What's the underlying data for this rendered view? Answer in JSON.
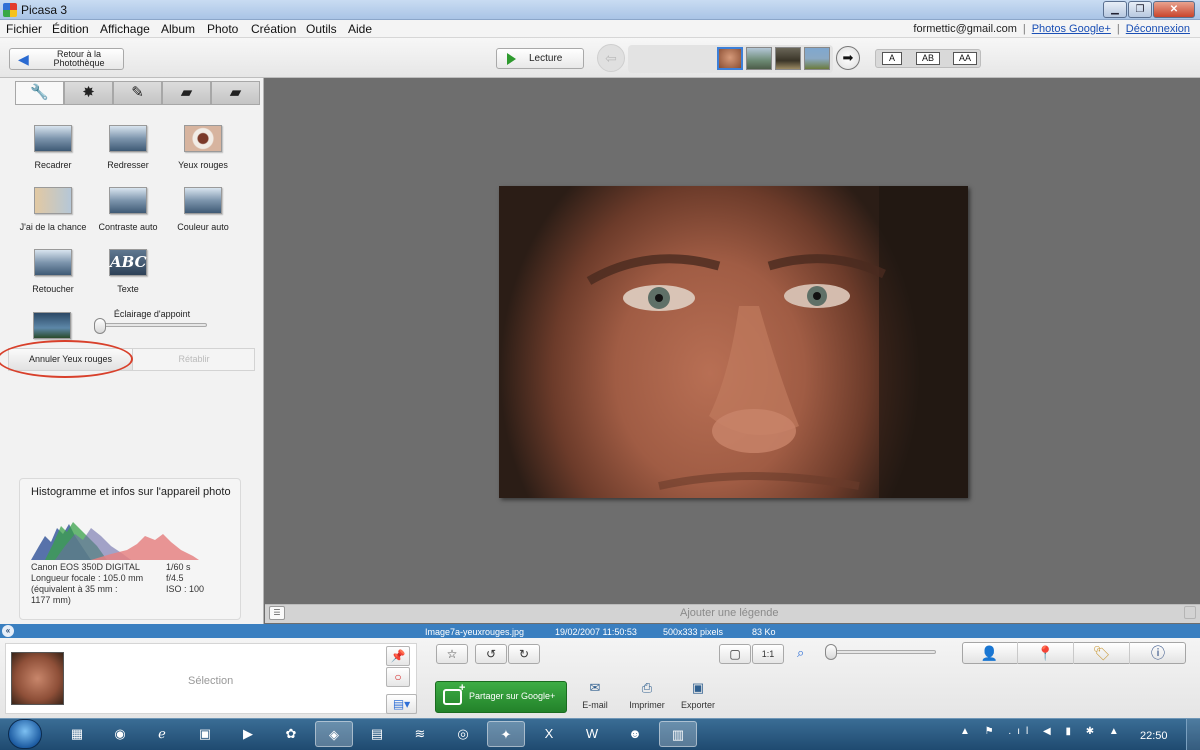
{
  "window": {
    "title": "Picasa 3"
  },
  "menu": [
    "Fichier",
    "Édition",
    "Affichage",
    "Album",
    "Photo",
    "Création",
    "Outils",
    "Aide"
  ],
  "account": {
    "email": "formettic@gmail.com",
    "photos_link": "Photos Google+",
    "logout": "Déconnexion"
  },
  "toolbar": {
    "back_label": "Retour à la Photothèque",
    "play_label": "Lecture",
    "caption_modes": [
      "A",
      "AB",
      "AA"
    ]
  },
  "tabs": [
    "wrench-icon",
    "sun-tuning-icon",
    "brush-icon",
    "effects-icon",
    "effects-2-icon"
  ],
  "tools": [
    {
      "label": "Recadrer",
      "icon": "crop-icon"
    },
    {
      "label": "Redresser",
      "icon": "straighten-icon"
    },
    {
      "label": "Yeux rouges",
      "icon": "red-eye-icon"
    },
    {
      "label": "J'ai de la chance",
      "icon": "lucky-icon"
    },
    {
      "label": "Contraste auto",
      "icon": "auto-contrast-icon"
    },
    {
      "label": "Couleur auto",
      "icon": "auto-color-icon"
    },
    {
      "label": "Retoucher",
      "icon": "retouch-icon"
    },
    {
      "label": "Texte",
      "icon": "text-icon",
      "glyph": "ABC"
    }
  ],
  "fill_light": {
    "label": "Éclairage d'appoint",
    "value": 0
  },
  "history": {
    "undo": "Annuler Yeux rouges",
    "redo": "Rétablir"
  },
  "histogram": {
    "title": "Histogramme et infos sur l'appareil photo",
    "exif_left": [
      "Canon EOS 350D DIGITAL",
      "Longueur focale : 105.0 mm",
      "(équivalent à 35 mm :",
      "1177 mm)"
    ],
    "exif_right": [
      "1/60 s",
      "f/4.5",
      "ISO : 100"
    ]
  },
  "caption": {
    "placeholder": "Ajouter une légende"
  },
  "infobar": {
    "filename": "Image7a-yeuxrouges.jpg",
    "datetime": "19/02/2007 11:50:53",
    "dimensions": "500x333 pixels",
    "size": "83 Ko"
  },
  "tray": {
    "selection_label": "Sélection",
    "share_label": "Partager sur Google+",
    "actions": [
      {
        "label": "E-mail",
        "icon": "email-icon"
      },
      {
        "label": "Imprimer",
        "icon": "print-icon"
      },
      {
        "label": "Exporter",
        "icon": "export-icon"
      }
    ],
    "zoom_buttons": [
      "1:1"
    ]
  },
  "taskbar": {
    "clock": "22:50"
  },
  "colors": {
    "accent": "#3a7fc0",
    "share_green": "#2e9a36",
    "annotation_red": "#d8402b",
    "workspace": "#6e6e6e"
  }
}
